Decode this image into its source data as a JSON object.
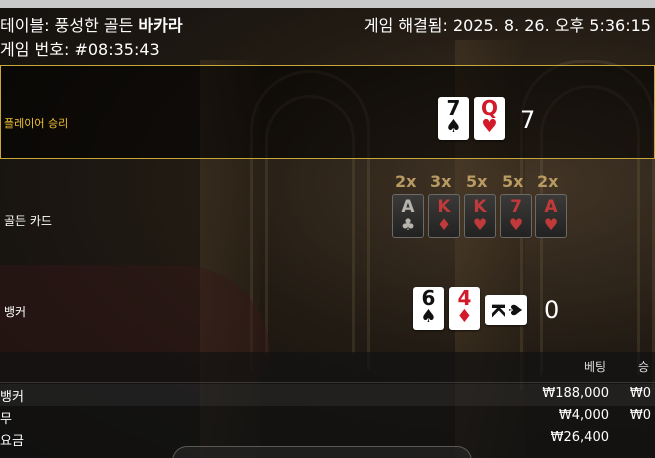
{
  "header": {
    "table_prefix": "테이블: 풍성한 골든",
    "table_game": "바카라",
    "resolved": "게임 해결됨: 2025. 8. 26. 오후 5:36:15",
    "round": "게임 번호: #08:35:43"
  },
  "player": {
    "label": "플레이어 승리",
    "score": "7",
    "cards": [
      {
        "rank": "7",
        "suit": "♠",
        "color": "black"
      },
      {
        "rank": "Q",
        "suit": "♥",
        "color": "red"
      }
    ]
  },
  "golden": {
    "label": "골든 카드",
    "multipliers": [
      "2x",
      "3x",
      "5x",
      "5x",
      "2x"
    ],
    "cards": [
      {
        "rank": "A",
        "suit": "♣",
        "color": "black"
      },
      {
        "rank": "K",
        "suit": "♦",
        "color": "red"
      },
      {
        "rank": "K",
        "suit": "♥",
        "color": "red"
      },
      {
        "rank": "7",
        "suit": "♥",
        "color": "red"
      },
      {
        "rank": "A",
        "suit": "♥",
        "color": "red"
      }
    ]
  },
  "banker": {
    "label": "뱅커",
    "score": "0",
    "cards": [
      {
        "rank": "6",
        "suit": "♠",
        "color": "black"
      },
      {
        "rank": "4",
        "suit": "♦",
        "color": "red"
      },
      {
        "rank": "K",
        "suit": "♠",
        "color": "black"
      }
    ]
  },
  "bets": {
    "header_bet": "베팅",
    "header_win": "승",
    "rows": [
      {
        "name": "뱅커",
        "amount": "₩188,000",
        "win": "₩0"
      },
      {
        "name": "무",
        "amount": "₩4,000",
        "win": "₩0"
      }
    ],
    "cut_row_name": "요금",
    "cut_row_amount": "₩26,400"
  },
  "colors": {
    "gold_border": "#c8a73a",
    "player_label": "#f2c230",
    "card_red": "#d21a2a"
  }
}
